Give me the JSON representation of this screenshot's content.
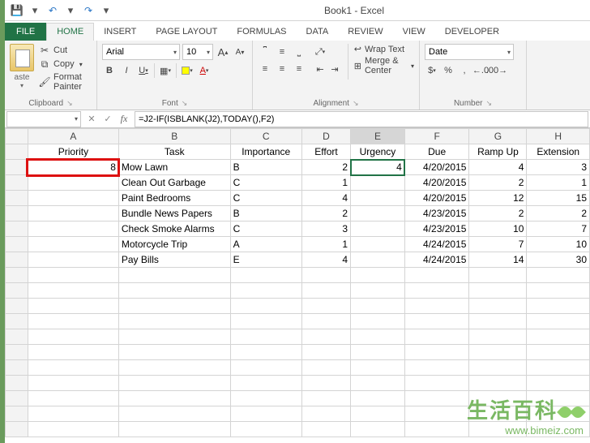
{
  "title": "Book1 - Excel",
  "qat": {
    "save": "💾",
    "undo": "↶",
    "redo": "↷"
  },
  "tabs": [
    "FILE",
    "HOME",
    "INSERT",
    "PAGE LAYOUT",
    "FORMULAS",
    "DATA",
    "REVIEW",
    "VIEW",
    "DEVELOPER"
  ],
  "active_tab": "HOME",
  "ribbon": {
    "clipboard": {
      "label": "Clipboard",
      "paste": "aste",
      "cut": "Cut",
      "copy": "Copy",
      "format_painter": "Format Painter"
    },
    "font": {
      "label": "Font",
      "name": "Arial",
      "size": "10",
      "grow": "A",
      "shrink": "A",
      "bold": "B",
      "italic": "I",
      "underline": "U"
    },
    "alignment": {
      "label": "Alignment",
      "wrap": "Wrap Text",
      "merge": "Merge & Center"
    },
    "number": {
      "label": "Number",
      "format": "Date",
      "currency": "$",
      "percent": "%",
      "comma": ",",
      "inc": ".0",
      "dec": ".00"
    }
  },
  "namebox": "",
  "formula": "=J2-IF(ISBLANK(J2),TODAY(),F2)",
  "columns": [
    "",
    "A",
    "B",
    "C",
    "D",
    "E",
    "F",
    "G",
    "H"
  ],
  "headers": {
    "A": "Priority",
    "B": "Task",
    "C": "Importance",
    "D": "Effort",
    "E": "Urgency",
    "F": "Due",
    "G": "Ramp Up",
    "H": "Extension"
  },
  "rows": [
    {
      "A": "8",
      "B": "Mow Lawn",
      "C": "B",
      "D": 2,
      "E": "4",
      "F": "4/20/2015",
      "G": 4,
      "H": 3
    },
    {
      "A": "",
      "B": "Clean Out Garbage",
      "C": "C",
      "D": 1,
      "E": "",
      "F": "4/20/2015",
      "G": 2,
      "H": 1
    },
    {
      "A": "",
      "B": "Paint Bedrooms",
      "C": "C",
      "D": 4,
      "E": "",
      "F": "4/20/2015",
      "G": 12,
      "H": 15
    },
    {
      "A": "",
      "B": "Bundle News Papers",
      "C": "B",
      "D": 2,
      "E": "",
      "F": "4/23/2015",
      "G": 2,
      "H": 2
    },
    {
      "A": "",
      "B": "Check Smoke Alarms",
      "C": "C",
      "D": 3,
      "E": "",
      "F": "4/23/2015",
      "G": 10,
      "H": 7
    },
    {
      "A": "",
      "B": "Motorcycle Trip",
      "C": "A",
      "D": 1,
      "E": "",
      "F": "4/24/2015",
      "G": 7,
      "H": 10
    },
    {
      "A": "",
      "B": "Pay Bills",
      "C": "E",
      "D": 4,
      "E": "",
      "F": "4/24/2015",
      "G": 14,
      "H": 30
    }
  ],
  "selected": {
    "col": "E",
    "row_index": 0
  },
  "highlight": {
    "A": 0,
    "E": 0
  },
  "watermark": {
    "text": "生活百科",
    "url": "www.bimeiz.com"
  }
}
